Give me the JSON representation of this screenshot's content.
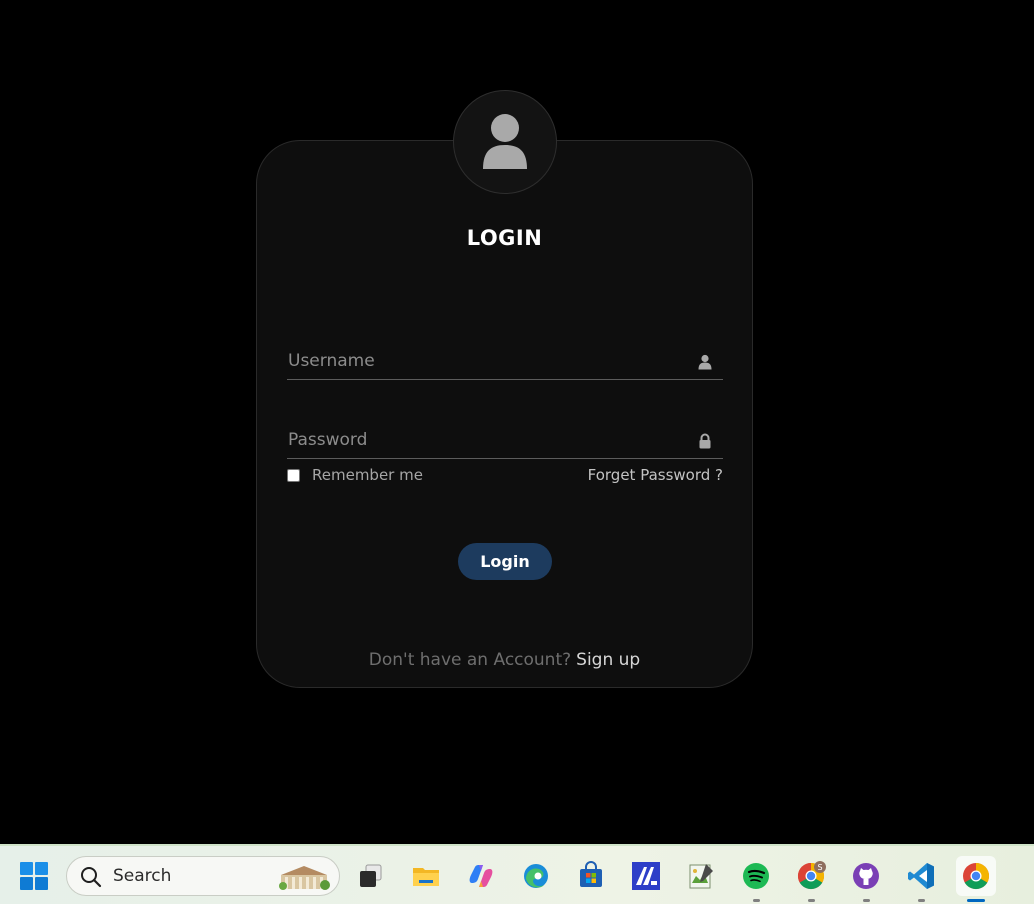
{
  "login": {
    "title": "LOGIN",
    "username_placeholder": "Username",
    "password_placeholder": "Password",
    "remember_label": "Remember me",
    "forgot_label": "Forget Password ?",
    "login_button": "Login",
    "signup_prompt": "Don't have an Account?",
    "signup_link": "Sign up",
    "icons": {
      "avatar": "user-avatar-icon",
      "username": "user-icon",
      "password": "lock-icon"
    },
    "colors": {
      "card_bg": "#0e0e0e",
      "button_bg": "#1d3b5e"
    }
  },
  "taskbar": {
    "search_label": "Search",
    "apps": [
      {
        "name": "task-view-icon"
      },
      {
        "name": "file-explorer-icon"
      },
      {
        "name": "copilot-icon"
      },
      {
        "name": "edge-icon"
      },
      {
        "name": "microsoft-store-icon"
      },
      {
        "name": "editor-app-icon"
      },
      {
        "name": "notepad-icon"
      },
      {
        "name": "spotify-icon"
      },
      {
        "name": "chrome-profile-icon",
        "badge": "S"
      },
      {
        "name": "github-icon"
      },
      {
        "name": "vscode-icon"
      },
      {
        "name": "chrome-icon"
      }
    ]
  }
}
